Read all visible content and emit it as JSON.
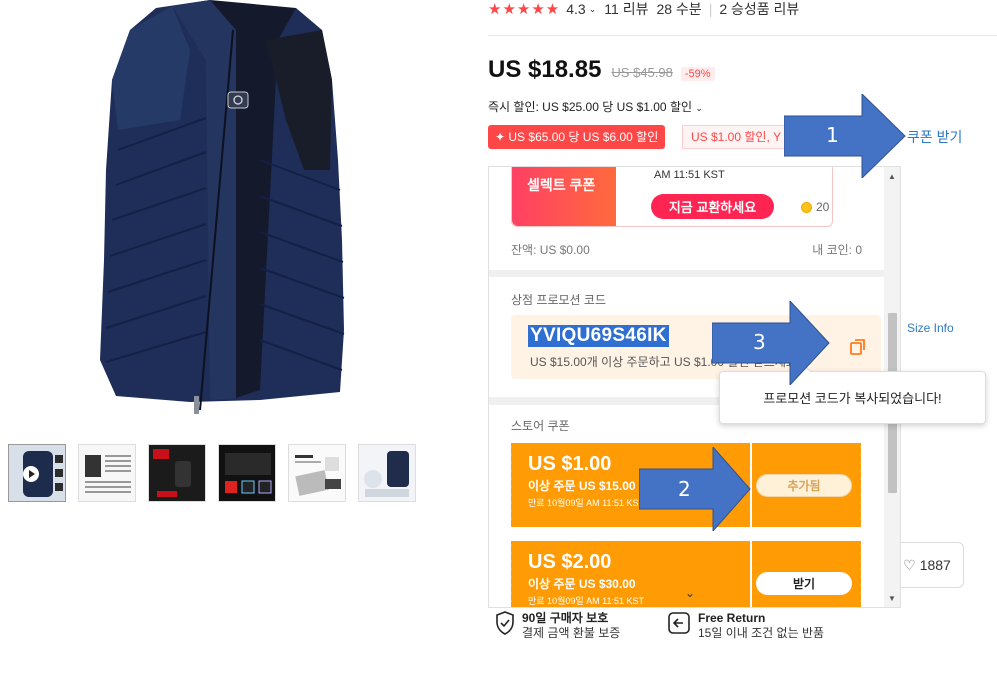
{
  "rating": {
    "stars": "★★★★★",
    "score": "4.3",
    "reviews": "11 리뷰",
    "sold": "28 수분",
    "photo_reviews": "2 승성품 리뷰"
  },
  "price": {
    "current": "US $18.85",
    "original": "US $45.98",
    "discount": "-59%"
  },
  "instant_discount": "즉시 할인: US $25.00 당 US $1.00 할인",
  "tags": {
    "red": "US $65.00 당 US $6.00 할인",
    "outline": "US $1.00 할인, Y"
  },
  "coupon_link": "쿠폰 받기",
  "size_info": "Size Info",
  "favorites_count": "1887",
  "protection": [
    {
      "title": "90일 구매자 보호",
      "subtitle": "결제 금액 환불 보증"
    },
    {
      "title": "Free Return",
      "subtitle": "15일 이내 조건 없는 반품"
    }
  ],
  "popup": {
    "select_coupon": {
      "label": "셀렉트 쿠폰",
      "time": "AM 11:51 KST",
      "exchange_button": "지금 교환하세요",
      "coins": "20"
    },
    "balance": "잔액: US $0.00",
    "my_coins": "내 코인: 0",
    "store_promo": {
      "title": "상점 프로모션 코드",
      "code": "YVIQU69S46IK",
      "description": "US $15.00개 이상 주문하고 US $1.00 할인 받으세요"
    },
    "store_coupons": {
      "title": "스토어 쿠폰",
      "items": [
        {
          "amount": "US $1.00",
          "condition": "이상 주문 US $15.00",
          "expiry": "만료 10월09일 AM 11:51 KST",
          "button": "추가됨"
        },
        {
          "amount": "US $2.00",
          "condition": "이상 주문 US $30.00",
          "expiry": "만료 10월09일 AM 11:51 KST",
          "button": "받기"
        }
      ]
    }
  },
  "toast": "프로모션 코드가 복사되었습니다!",
  "annotations": [
    "1",
    "2",
    "3"
  ],
  "colors": {
    "accent_red": "#ff4747",
    "coupon_orange": "#ff9b05",
    "link_blue": "#2e7bc3",
    "annotation_arrow": "#4472c4"
  }
}
